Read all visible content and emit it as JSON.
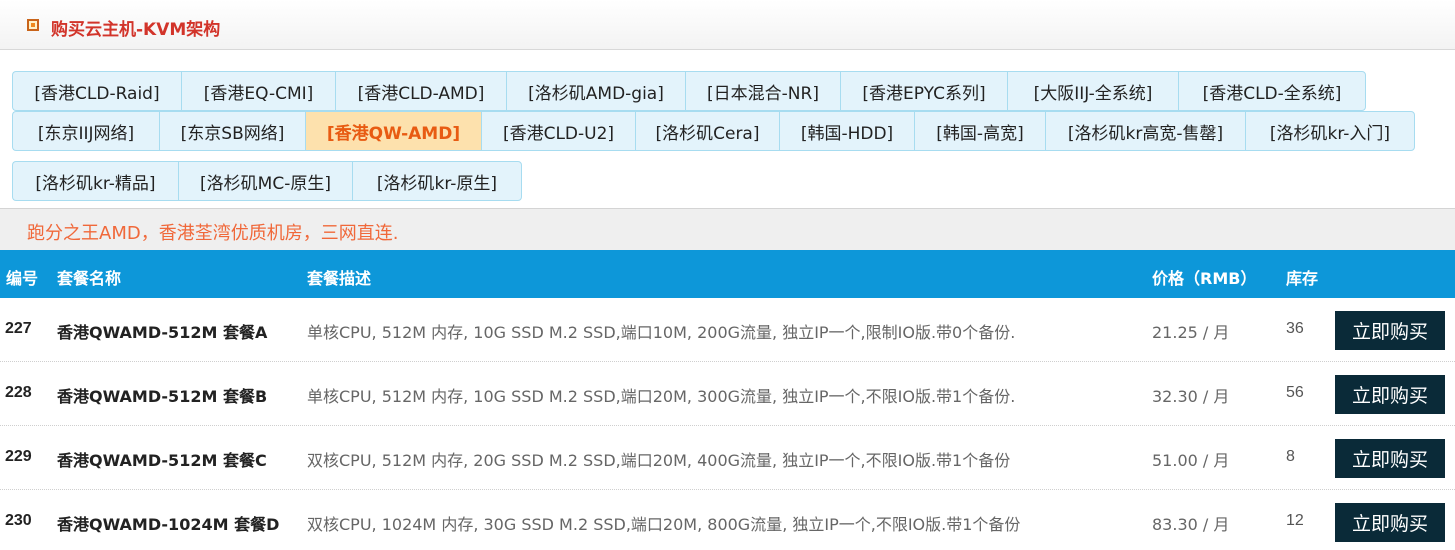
{
  "header": {
    "title": "购买云主机-KVM架构"
  },
  "tabs": {
    "row1": [
      "[香港CLD-Raid]",
      "[香港EQ-CMI]",
      "[香港CLD-AMD]",
      "[洛杉矶AMD-gia]",
      "[日本混合-NR]",
      "[香港EPYC系列]",
      "[大阪IIJ-全系统]",
      "[香港CLD-全系统]"
    ],
    "row2": [
      "[东京IIJ网络]",
      "[东京SB网络]",
      "[香港QW-AMD]",
      "[香港CLD-U2]",
      "[洛杉矶Cera]",
      "[韩国-HDD]",
      "[韩国-高宽]",
      "[洛杉矶kr高宽-售罄]",
      "[洛杉矶kr-入门]"
    ],
    "row3": [
      "[洛杉矶kr-精品]",
      "[洛杉矶MC-原生]",
      "[洛杉矶kr-原生]"
    ],
    "active": "[香港QW-AMD]"
  },
  "notice": "跑分之王AMD，香港荃湾优质机房，三网直连.",
  "table": {
    "headers": {
      "id": "编号",
      "name": "套餐名称",
      "desc": "套餐描述",
      "price": "价格（RMB）",
      "stock": "库存"
    },
    "rows": [
      {
        "id": "227",
        "name": "香港QWAMD-512M 套餐A",
        "desc": "单核CPU, 512M 内存, 10G SSD M.2 SSD,端口10M, 200G流量, 独立IP一个,限制IO版.带0个备份.",
        "price": "21.25 / 月",
        "stock": "36",
        "button": "立即购买"
      },
      {
        "id": "228",
        "name": "香港QWAMD-512M 套餐B",
        "desc": "单核CPU, 512M 内存, 10G SSD M.2 SSD,端口20M, 300G流量, 独立IP一个,不限IO版.带1个备份.",
        "price": "32.30 / 月",
        "stock": "56",
        "button": "立即购买"
      },
      {
        "id": "229",
        "name": "香港QWAMD-512M 套餐C",
        "desc": "双核CPU, 512M 内存, 20G SSD M.2 SSD,端口20M, 400G流量, 独立IP一个,不限IO版.带1个备份",
        "price": "51.00 / 月",
        "stock": "8",
        "button": "立即购买"
      },
      {
        "id": "230",
        "name": "香港QWAMD-1024M 套餐D",
        "desc": "双核CPU, 1024M 内存, 30G SSD M.2 SSD,端口20M, 800G流量, 独立IP一个,不限IO版.带1个备份",
        "price": "83.30 / 月",
        "stock": "12",
        "button": "立即购买"
      }
    ]
  }
}
